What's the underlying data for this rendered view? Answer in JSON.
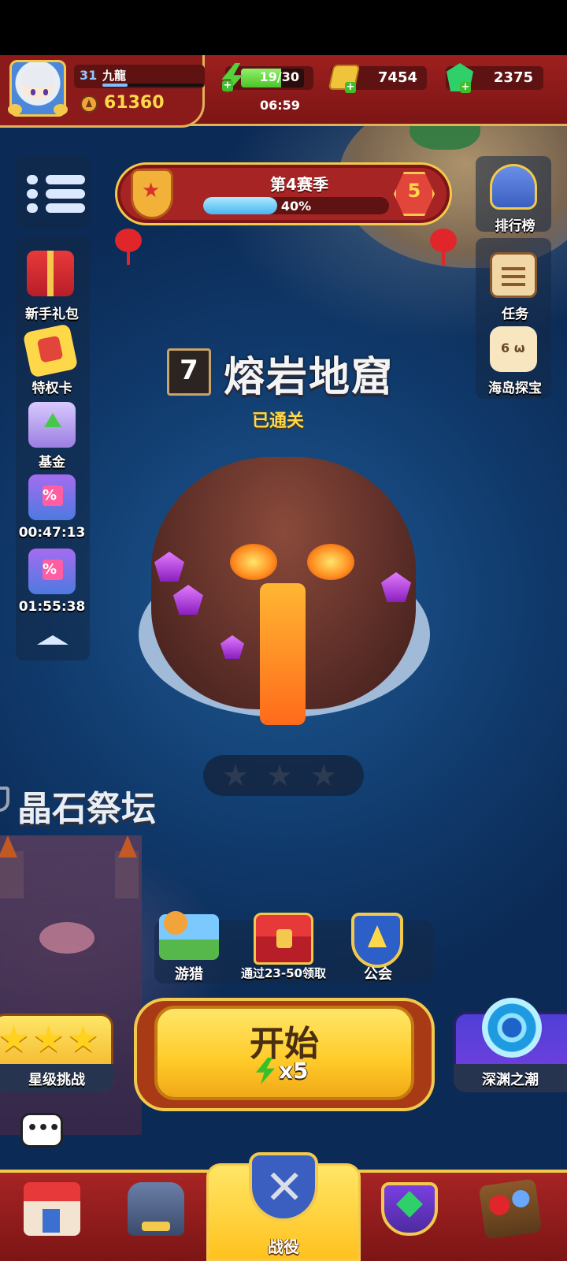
{
  "header": {
    "player_level": "31",
    "player_name": "九龍",
    "xp_fraction": 0.25,
    "power": "61360",
    "energy": "19/30",
    "energy_fraction": 0.633,
    "energy_timer": "06:59",
    "gold": "7454",
    "gems": "2375",
    "icons": [
      "avatar",
      "power-icon",
      "energy-icon",
      "gold-icon",
      "gem-icon"
    ]
  },
  "season": {
    "title": "第4赛季",
    "progress_text": "40%",
    "progress_fraction": 0.4,
    "level": "5"
  },
  "left_sidebar": {
    "items": [
      {
        "label": "新手礼包",
        "icon": "gift-icon"
      },
      {
        "label": "特权卡",
        "icon": "privilege-card-icon"
      },
      {
        "label": "基金",
        "icon": "fund-chest-icon"
      },
      {
        "label": "00:47:13",
        "icon": "sale-gift-icon"
      },
      {
        "label": "01:55:38",
        "icon": "sale-gift-icon"
      }
    ]
  },
  "right_sidebar": {
    "items": [
      {
        "label": "排行榜",
        "icon": "leaderboard-icon"
      },
      {
        "label": "任务",
        "icon": "task-icon"
      },
      {
        "label": "海岛探宝",
        "icon": "dice-icon"
      }
    ]
  },
  "stage": {
    "number": "7",
    "name": "熔岩地窟",
    "status": "已通关",
    "stars_earned": 0,
    "stars_total": 3
  },
  "next_stage": {
    "name": "晶石祭坛"
  },
  "quick_actions": [
    {
      "label": "游猎",
      "icon": "hunt-icon"
    },
    {
      "label": "通过23-50领取",
      "icon": "locked-chest-icon"
    },
    {
      "label": "公会",
      "icon": "guild-icon"
    }
  ],
  "start": {
    "label": "开始",
    "cost": "x5"
  },
  "side_modes": {
    "left": "星级挑战",
    "right": "深渊之潮"
  },
  "bottom_nav": {
    "active_label": "战役",
    "tabs": [
      "shop-icon",
      "cannon-icon",
      "battle-icon",
      "trophy-icon",
      "map-icon"
    ]
  },
  "colors": {
    "header_red": "#9e1f1f",
    "gold_trim": "#f2c94c",
    "start_yellow": "#ffca28",
    "energy_green": "#4cc42a",
    "ocean": "#1f5a94"
  }
}
